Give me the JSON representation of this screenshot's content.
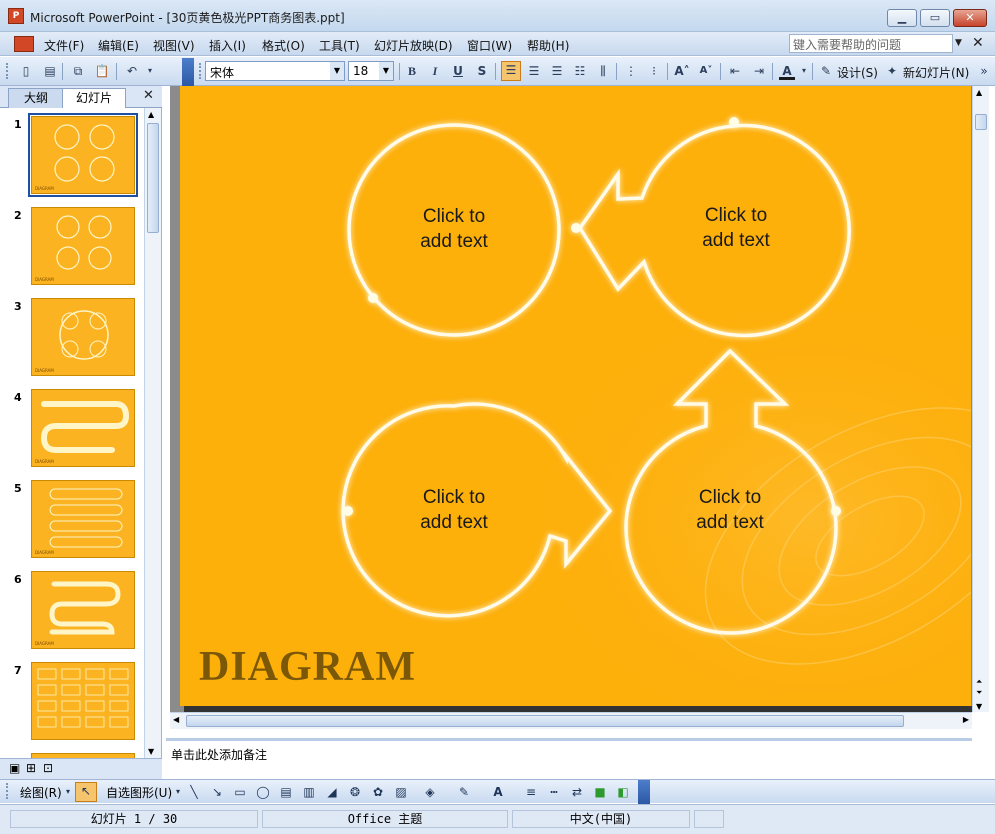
{
  "window": {
    "app_icon": "powerpoint-icon",
    "title": "Microsoft PowerPoint - [30页黄色极光PPT商务图表.ppt]",
    "buttons": [
      "minimize",
      "maximize",
      "close"
    ]
  },
  "menubar": {
    "items": [
      "文件(F)",
      "编辑(E)",
      "视图(V)",
      "插入(I)",
      "格式(O)",
      "工具(T)",
      "幻灯片放映(D)",
      "窗口(W)",
      "帮助(H)"
    ],
    "help_placeholder": "键入需要帮助的问题"
  },
  "toolbar": {
    "font": "宋体",
    "size": "18",
    "bold": "B",
    "italic": "I",
    "underline": "U",
    "shadow": "S",
    "design_label": "设计(S)",
    "new_slide_label": "新幻灯片(N)"
  },
  "left_pane": {
    "tabs": [
      "大纲",
      "幻灯片"
    ],
    "active_tab": "幻灯片",
    "slides": [
      {
        "number": "1",
        "caption": "DIAGRAM"
      },
      {
        "number": "2",
        "caption": "DIAGRAM"
      },
      {
        "number": "3",
        "caption": "DIAGRAM"
      },
      {
        "number": "4",
        "caption": "DIAGRAM"
      },
      {
        "number": "5",
        "caption": "DIAGRAM"
      },
      {
        "number": "6",
        "caption": "DIAGRAM"
      },
      {
        "number": "7",
        "caption": "DIAGRAM"
      }
    ],
    "selected_slide": "1"
  },
  "slide": {
    "background_color": "#fdaf0a",
    "title": "DIAGRAM",
    "placeholders": [
      {
        "line1": "Click to",
        "line2": "add text"
      },
      {
        "line1": "Click to",
        "line2": "add text"
      },
      {
        "line1": "Click to",
        "line2": "add text"
      },
      {
        "line1": "Click to",
        "line2": "add text"
      }
    ]
  },
  "notes": {
    "placeholder": "单击此处添加备注"
  },
  "drawing_toolbar": {
    "draw_label": "绘图(R)",
    "autoshapes_label": "自选图形(U)"
  },
  "statusbar": {
    "slide_position": "幻灯片 1 / 30",
    "theme": "Office 主题",
    "language": "中文(中国)"
  }
}
